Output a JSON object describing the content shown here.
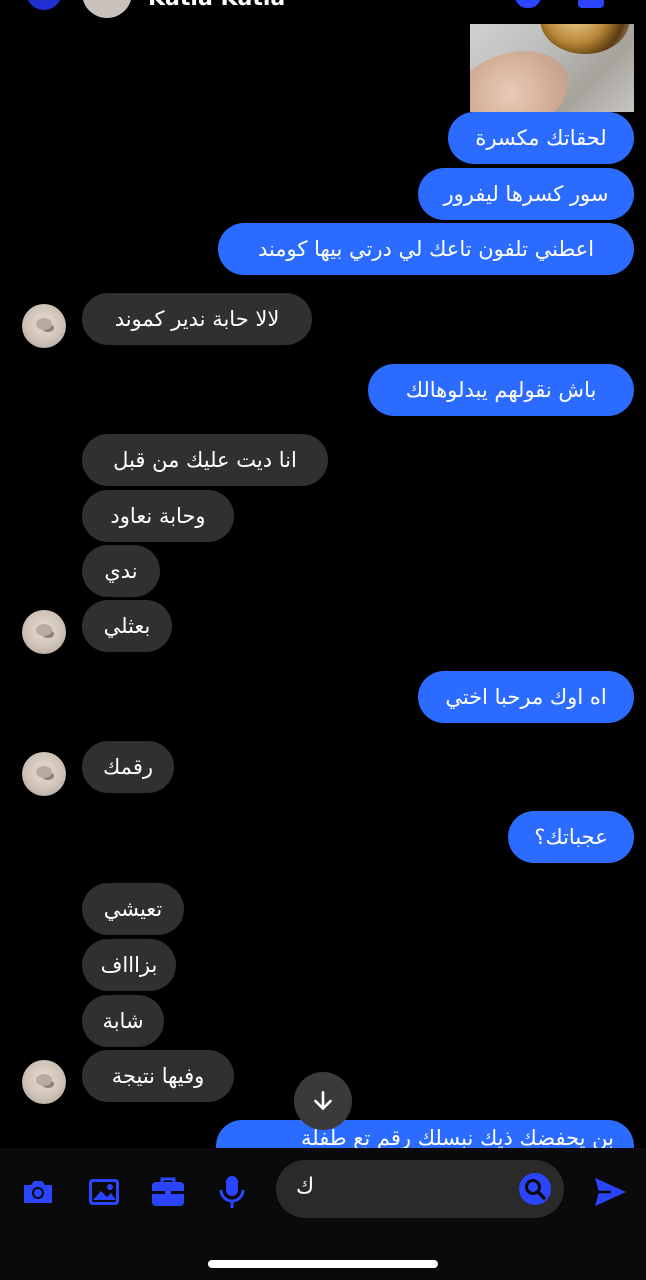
{
  "header": {
    "contact_name": "Katia Katia"
  },
  "messages": [
    {
      "text": "لحقاتك مكسرة",
      "direction": "outgoing"
    },
    {
      "text": "سور كسرها ليفرور",
      "direction": "outgoing"
    },
    {
      "text": "اعطني تلفون تاعك لي درتي بيها كومند",
      "direction": "outgoing"
    },
    {
      "text": "لالا حابة ندير كموند",
      "direction": "incoming"
    },
    {
      "text": "باش نقولهم يبدلوهالك",
      "direction": "outgoing"
    },
    {
      "text": "انا ديت عليك من قبل",
      "direction": "incoming"
    },
    {
      "text": "وحابة نعاود",
      "direction": "incoming"
    },
    {
      "text": "ندي",
      "direction": "incoming"
    },
    {
      "text": "بعثلي",
      "direction": "incoming"
    },
    {
      "text": "اه اوك مرحبا اختي",
      "direction": "outgoing"
    },
    {
      "text": "رقمك",
      "direction": "incoming"
    },
    {
      "text": "عجباتك؟",
      "direction": "outgoing"
    },
    {
      "text": "تعيشي",
      "direction": "incoming"
    },
    {
      "text": "بزاااف",
      "direction": "incoming"
    },
    {
      "text": "شابة",
      "direction": "incoming"
    },
    {
      "text": "وفيها نتيجة",
      "direction": "incoming"
    },
    {
      "text": "بن يحفضك ذيك نبسلك رقم تع طفلة",
      "direction": "outgoing"
    }
  ],
  "composer": {
    "input_value": "ك",
    "tools": [
      "camera-icon",
      "gallery-icon",
      "briefcase-icon",
      "microphone-icon"
    ],
    "send_icon": "send-icon",
    "emoji_icon": "emoji-search-icon"
  },
  "colors": {
    "outgoing": "#2b6bff",
    "incoming": "#303030",
    "accent": "#2b45ff",
    "background": "#000000"
  }
}
